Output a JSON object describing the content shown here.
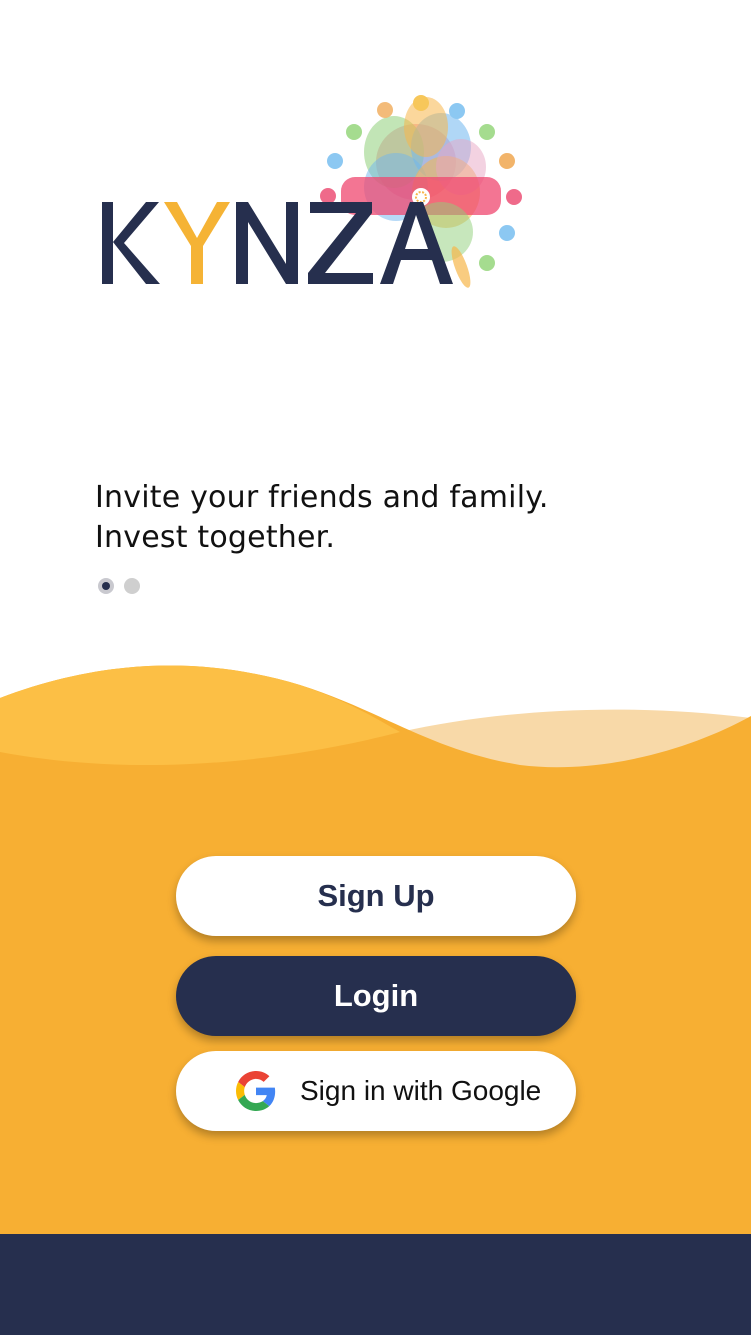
{
  "logo": {
    "letters": [
      "K",
      "Y",
      "N",
      "Z",
      "A"
    ],
    "navy": "#262f4e",
    "accent_yellow": "#f5b335"
  },
  "onboarding": {
    "tagline_line1": "Invite your friends and family.",
    "tagline_line2": "Invest together.",
    "page_count": 2,
    "active_page": 1
  },
  "actions": {
    "signup_label": "Sign Up",
    "login_label": "Login",
    "google_label": "Sign in with Google"
  },
  "icons": {
    "google": "google-g-icon",
    "logo_mark": "kynza-burst-icon"
  },
  "colors": {
    "orange": "#f7af33",
    "light_orange": "#fcbf45",
    "pale_orange": "#f8d9a8",
    "navy": "#262f4e",
    "white": "#ffffff"
  }
}
